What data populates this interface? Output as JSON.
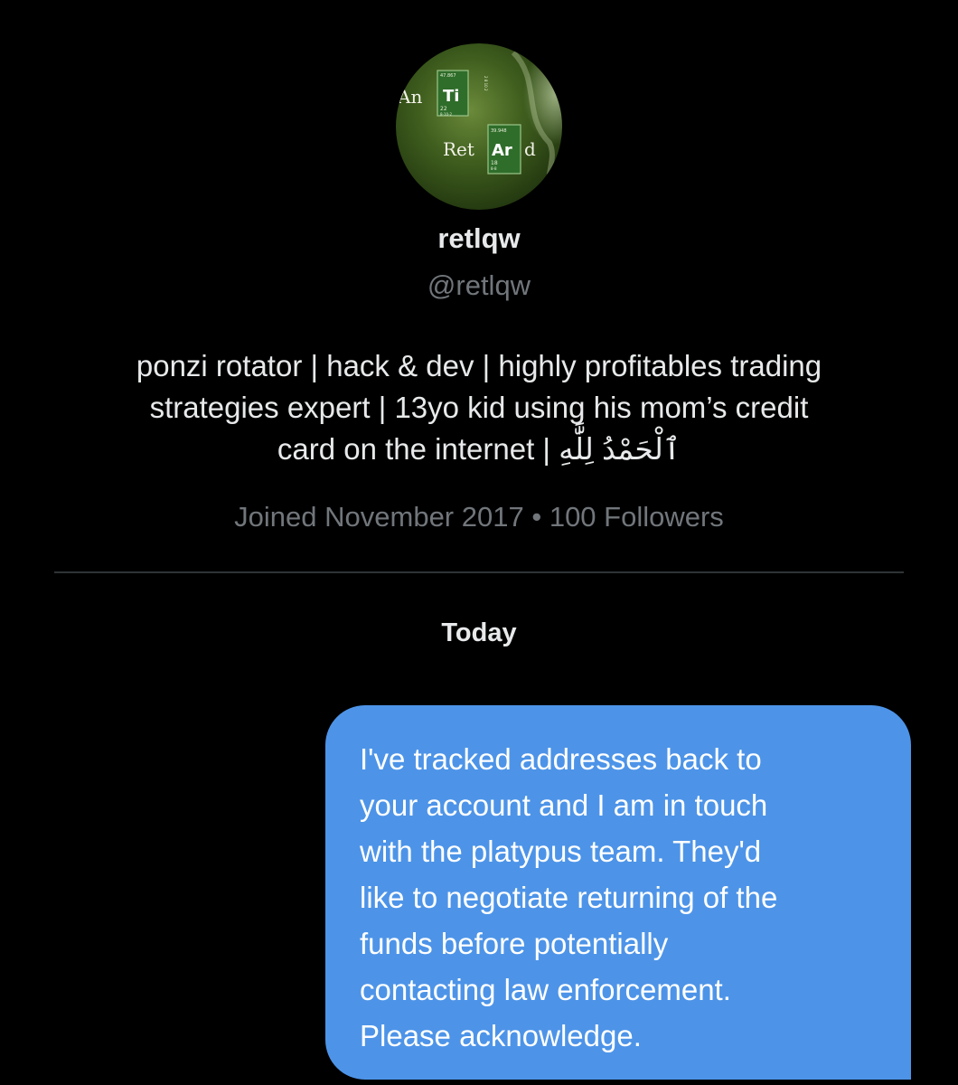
{
  "profile": {
    "avatar_label": {
      "line1": [
        "An",
        "Ti"
      ],
      "line2": [
        "Ret",
        "Ar",
        "d"
      ],
      "ti_small": [
        "47.867",
        "22",
        "8-10-2",
        "2 8 10 2"
      ],
      "ar_small": [
        "39.948",
        "18",
        "8-8"
      ]
    },
    "display_name": "retlqw",
    "handle": "@retlqw",
    "bio_lines": [
      "ponzi rotator | hack & dev | highly profitables trading",
      "strategies expert | 13yo kid using his mom’s credit",
      "card on the internet | ٱلْحَمْدُ لِلَّٰهِ"
    ],
    "joined": "Joined November 2017",
    "separator": "•",
    "followers": "100 Followers"
  },
  "conversation": {
    "date_header": "Today",
    "message_lines": [
      "I've tracked addresses back to",
      "your account and I am in touch",
      "with the platypus team. They'd",
      "like to negotiate returning of the",
      "funds before potentially",
      "contacting law enforcement.",
      "Please acknowledge."
    ]
  },
  "colors": {
    "background": "#000000",
    "primary_text": "#e7e9ea",
    "secondary_text": "#71767b",
    "divider": "#2f3336",
    "bubble": "#4d94e8",
    "bubble_text": "#ffffff",
    "avatar_green": "#3a5a1c",
    "element_tile": "#2d6b2a"
  }
}
